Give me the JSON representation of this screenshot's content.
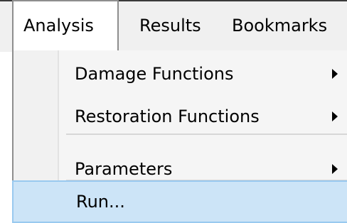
{
  "menubar": {
    "items": [
      {
        "label": "Analysis"
      },
      {
        "label": "Results"
      },
      {
        "label": "Bookmarks"
      }
    ]
  },
  "dropdown": {
    "items": [
      {
        "label": "Damage Functions",
        "has_submenu": true
      },
      {
        "label": "Restoration Functions",
        "has_submenu": true
      },
      {
        "label": "Parameters",
        "has_submenu": true
      },
      {
        "label": "Run...",
        "has_submenu": false,
        "highlighted": true
      }
    ]
  },
  "colors": {
    "menubar_bg": "#f0f0f0",
    "menu_bg": "#f5f5f5",
    "highlight_bg": "#cce4f7",
    "highlight_border": "#99c9ef"
  },
  "icons": {
    "submenu_arrow": "submenu-arrow-icon"
  }
}
